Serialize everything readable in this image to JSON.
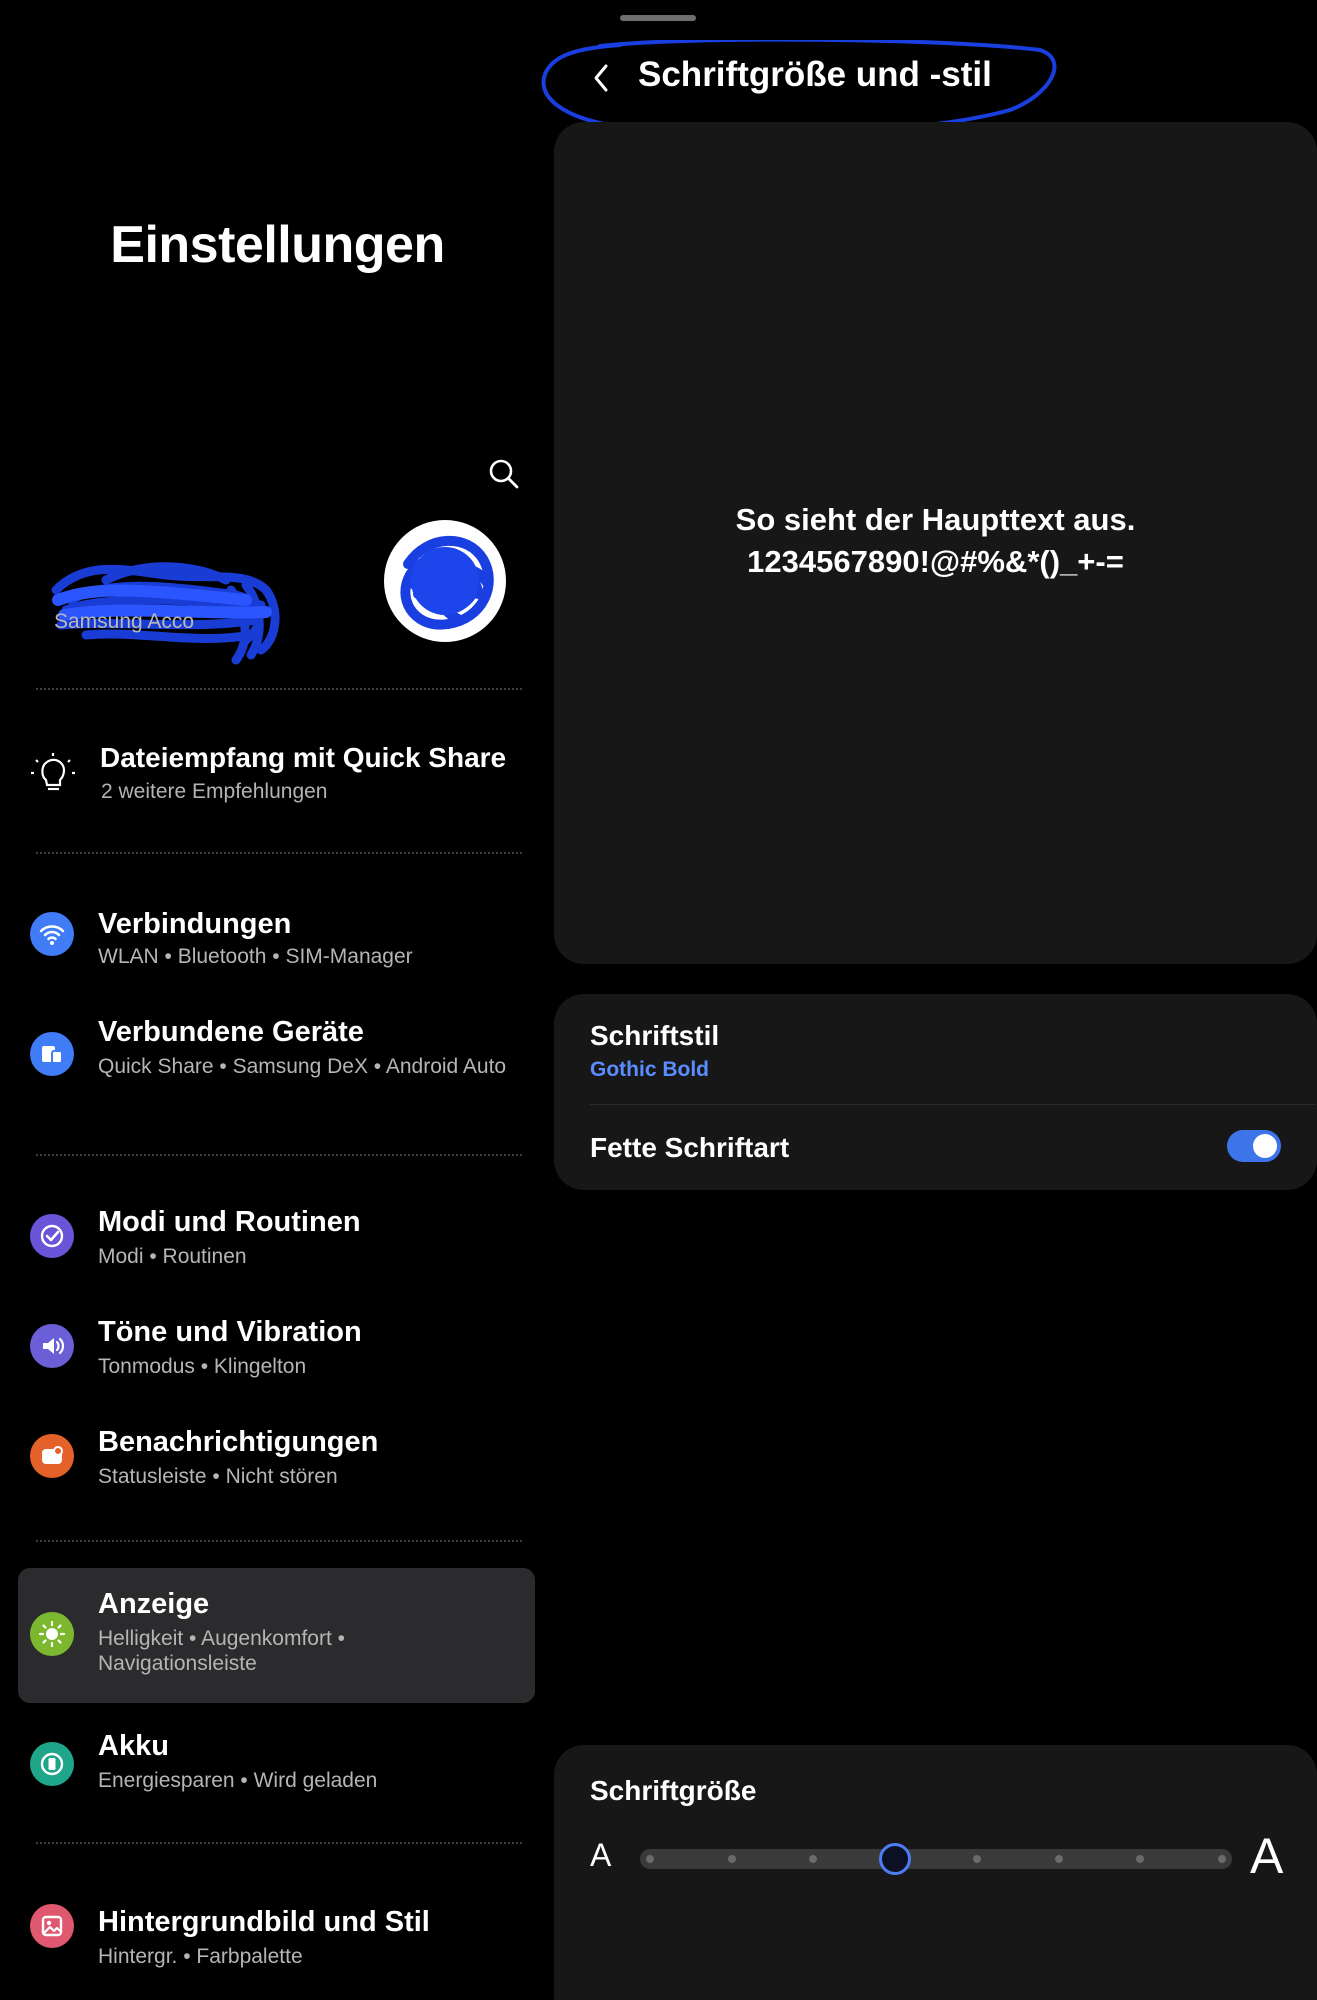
{
  "left": {
    "title": "Einstellungen",
    "account": {
      "label": "Samsung Acco"
    },
    "tip": {
      "title": "Dateiempfang mit Quick Share",
      "subtitle": "2 weitere Empfehlungen"
    },
    "items": [
      {
        "title": "Verbindungen",
        "subtitle": "WLAN • Bluetooth • SIM-Manager",
        "icon": "wifi-icon",
        "color": "#3f7cf5"
      },
      {
        "title": "Verbundene Geräte",
        "subtitle": "Quick Share • Samsung DeX • Android Auto",
        "icon": "devices-icon",
        "color": "#3f7cf5"
      },
      {
        "title": "Modi und Routinen",
        "subtitle": "Modi • Routinen",
        "icon": "check-circle-icon",
        "color": "#6a55d8"
      },
      {
        "title": "Töne und Vibration",
        "subtitle": "Tonmodus • Klingelton",
        "icon": "speaker-icon",
        "color": "#6a5fd6"
      },
      {
        "title": "Benachrichtigungen",
        "subtitle": "Statusleiste • Nicht stören",
        "icon": "notification-icon",
        "color": "#e4612a"
      },
      {
        "title": "Anzeige",
        "subtitle": "Helligkeit • Augenkomfort • Navigationsleiste",
        "icon": "sun-icon",
        "color": "#7cb82f",
        "active": true
      },
      {
        "title": "Akku",
        "subtitle": "Energiesparen • Wird geladen",
        "icon": "battery-icon",
        "color": "#1fa58a"
      },
      {
        "title": "Hintergrundbild und Stil",
        "subtitle": "Hintergr. • Farbpalette",
        "icon": "wallpaper-icon",
        "color": "#e0586f"
      }
    ]
  },
  "right": {
    "title": "Schriftgröße und -stil",
    "preview": {
      "line1": "So sieht der Haupttext aus.",
      "line2": "1234567890!@#%&*()_+-="
    },
    "font_style": {
      "label": "Schriftstil",
      "value": "Gothic Bold"
    },
    "bold_font": {
      "label": "Fette Schriftart",
      "enabled": true
    },
    "font_size": {
      "label": "Schriftgröße",
      "small_label": "A",
      "large_label": "A",
      "steps": 8,
      "selected_step": 4
    }
  },
  "colors": {
    "accent": "#4d7cf3",
    "card": "#171717",
    "background": "#000000",
    "annotation": "#1a3fe0"
  }
}
